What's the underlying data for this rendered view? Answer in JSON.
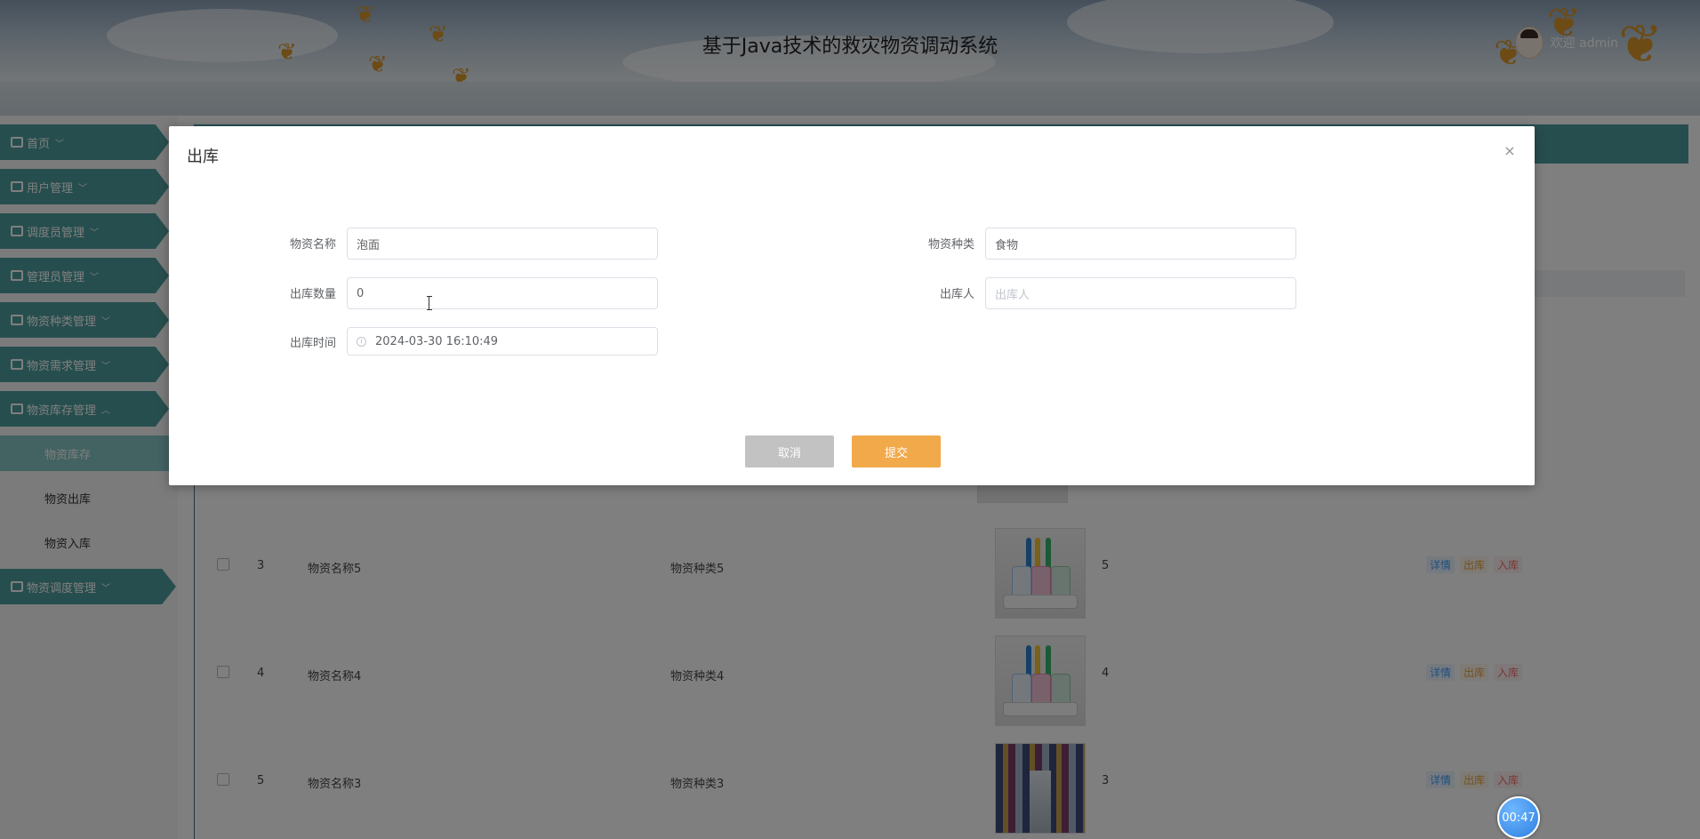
{
  "header": {
    "title": "基于Java技术的救灾物资调动系统",
    "welcome": "欢迎 admin"
  },
  "sidebar": {
    "items": [
      {
        "label": "首页",
        "icon": "home-icon"
      },
      {
        "label": "用户管理",
        "icon": "user-icon"
      },
      {
        "label": "调度员管理",
        "icon": "briefcase-icon"
      },
      {
        "label": "管理员管理",
        "icon": "briefcase-icon"
      },
      {
        "label": "物资种类管理",
        "icon": "copy-icon"
      },
      {
        "label": "物资需求管理",
        "icon": "briefcase-icon"
      },
      {
        "label": "物资库存管理",
        "icon": "wallet-icon"
      }
    ],
    "subitems": [
      {
        "label": "物资库存",
        "active": true
      },
      {
        "label": "物资出库",
        "active": false
      },
      {
        "label": "物资入库",
        "active": false
      }
    ],
    "last_item": {
      "label": "物资调度管理",
      "icon": "clipboard-icon"
    }
  },
  "table": {
    "rows": [
      {
        "index": "3",
        "name": "物资名称5",
        "category": "物资种类5",
        "quantity": "5"
      },
      {
        "index": "4",
        "name": "物资名称4",
        "category": "物资种类4",
        "quantity": "4"
      },
      {
        "index": "5",
        "name": "物资名称3",
        "category": "物资种类3",
        "quantity": "3"
      }
    ],
    "actions": {
      "detail": "详情",
      "out": "出库",
      "in": "入库"
    }
  },
  "dialog": {
    "title": "出库",
    "close": "×",
    "fields": {
      "name": {
        "label": "物资名称",
        "value": "泡面"
      },
      "category": {
        "label": "物资种类",
        "value": "食物"
      },
      "quantity": {
        "label": "出库数量",
        "value": "0"
      },
      "person": {
        "label": "出库人",
        "value": "",
        "placeholder": "出库人"
      },
      "time": {
        "label": "出库时间",
        "value": "2024-03-30 16:10:49"
      }
    },
    "cancel_label": "取消",
    "submit_label": "提交"
  },
  "timer": {
    "text": "00:47"
  },
  "colors": {
    "accent": "#4f9d9d",
    "submit": "#f1a94a",
    "cancel": "#c2c2c2"
  }
}
